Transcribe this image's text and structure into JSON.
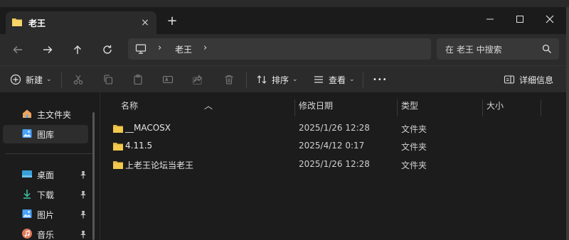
{
  "tab": {
    "title": "老王",
    "close": "×",
    "new_tab": "+"
  },
  "window_controls": {
    "minimize": "—",
    "maximize": "☐",
    "close": "✕"
  },
  "nav": {
    "breadcrumb_sep1": "›",
    "breadcrumb_current": "老王",
    "breadcrumb_sep2": "›",
    "search_placeholder": "在 老王 中搜索"
  },
  "toolbar": {
    "new_label": "新建",
    "sort_label": "排序",
    "view_label": "查看",
    "more_label": "•••",
    "details_label": "详细信息",
    "chevron": "⌄"
  },
  "sidebar": {
    "items": [
      {
        "label": "主文件夹",
        "icon": "home-icon"
      },
      {
        "label": "图库",
        "icon": "gallery-icon"
      },
      {
        "label": "桌面",
        "icon": "desktop-icon",
        "pin": "📌"
      },
      {
        "label": "下载",
        "icon": "download-icon",
        "pin": "📌"
      },
      {
        "label": "图片",
        "icon": "pictures-icon",
        "pin": "📌"
      },
      {
        "label": "音乐",
        "icon": "music-icon",
        "pin": "📌"
      }
    ]
  },
  "columns": {
    "name": "名称",
    "modified": "修改日期",
    "type": "类型",
    "size": "大小"
  },
  "files": [
    {
      "name": "__MACOSX",
      "modified": "2025/1/26 12:28",
      "type": "文件夹"
    },
    {
      "name": "4.11.5",
      "modified": "2025/4/12 0:17",
      "type": "文件夹"
    },
    {
      "name": "上老王论坛当老王",
      "modified": "2025/1/26 12:28",
      "type": "文件夹"
    }
  ],
  "colors": {
    "folder": "#f2c94c",
    "accent": "#4aa3ff"
  }
}
